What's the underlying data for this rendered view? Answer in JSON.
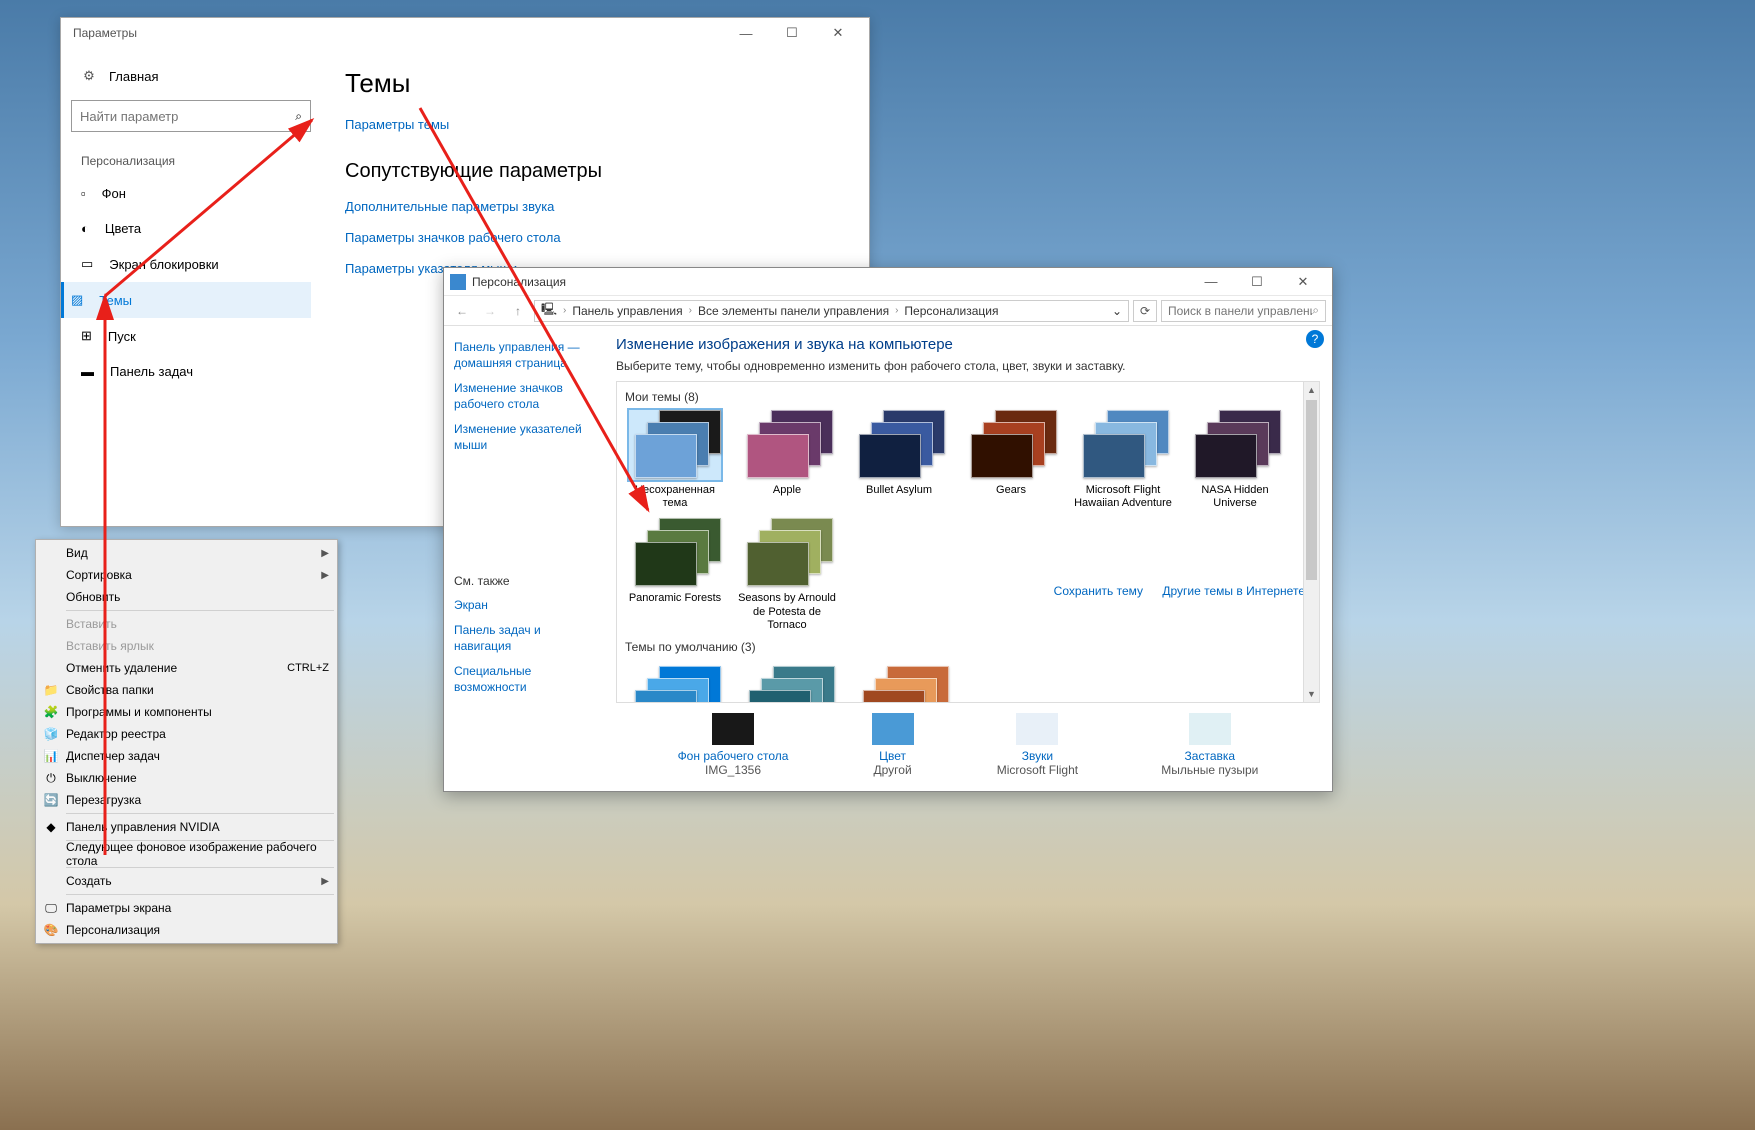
{
  "settings": {
    "title": "Параметры",
    "home": "Главная",
    "search_placeholder": "Найти параметр",
    "section_header": "Персонализация",
    "nav": [
      {
        "label": "Фон"
      },
      {
        "label": "Цвета"
      },
      {
        "label": "Экран блокировки"
      },
      {
        "label": "Темы"
      },
      {
        "label": "Пуск"
      },
      {
        "label": "Панель задач"
      }
    ],
    "page_title": "Темы",
    "link_theme_params": "Параметры темы",
    "related_header": "Сопутствующие параметры",
    "related_links": [
      "Дополнительные параметры звука",
      "Параметры значков рабочего стола",
      "Параметры указателя мыши"
    ]
  },
  "context_menu": {
    "items": [
      {
        "label": "Вид",
        "arrow": true
      },
      {
        "label": "Сортировка",
        "arrow": true
      },
      {
        "label": "Обновить"
      },
      {
        "sep": true
      },
      {
        "label": "Вставить",
        "disabled": true
      },
      {
        "label": "Вставить ярлык",
        "disabled": true
      },
      {
        "label": "Отменить удаление",
        "shortcut": "CTRL+Z"
      },
      {
        "label": "Свойства папки",
        "icon": "folder"
      },
      {
        "label": "Программы и компоненты",
        "icon": "programs"
      },
      {
        "label": "Редактор реестра",
        "icon": "regedit"
      },
      {
        "label": "Диспетчер задач",
        "icon": "taskmgr"
      },
      {
        "label": "Выключение",
        "icon": "power"
      },
      {
        "label": "Перезагрузка",
        "icon": "restart"
      },
      {
        "sep": true
      },
      {
        "label": "Панель управления NVIDIA",
        "icon": "nvidia"
      },
      {
        "sep": true
      },
      {
        "label": "Следующее фоновое изображение рабочего стола"
      },
      {
        "sep": true
      },
      {
        "label": "Создать",
        "arrow": true
      },
      {
        "sep": true
      },
      {
        "label": "Параметры экрана",
        "icon": "display"
      },
      {
        "label": "Персонализация",
        "icon": "personalize"
      }
    ]
  },
  "cp": {
    "title": "Персонализация",
    "breadcrumbs": [
      "Панель управления",
      "Все элементы панели управления",
      "Персонализация"
    ],
    "search_placeholder": "Поиск в панели управления",
    "side_links": [
      "Панель управления — домашняя страница",
      "Изменение значков рабочего стола",
      "Изменение указателей мыши"
    ],
    "see_also_header": "См. также",
    "see_also": [
      "Экран",
      "Панель задач и навигация",
      "Специальные возможности"
    ],
    "heading": "Изменение изображения и звука на компьютере",
    "subheading": "Выберите тему, чтобы одновременно изменить фон рабочего стола, цвет, звуки и заставку.",
    "my_themes_label": "Мои темы (8)",
    "themes": [
      {
        "label": "Несохраненная тема",
        "colors": [
          "#1a1a1a",
          "#4a7eb0",
          "#6da2d8"
        ],
        "selected": true
      },
      {
        "label": "Apple",
        "colors": [
          "#4a2f5a",
          "#6a3a6a",
          "#b05580"
        ]
      },
      {
        "label": "Bullet Asylum",
        "colors": [
          "#2a3a6a",
          "#3a5aa0",
          "#102040"
        ]
      },
      {
        "label": "Gears",
        "colors": [
          "#6a2a10",
          "#a84020",
          "#301000"
        ]
      },
      {
        "label": "Microsoft Flight Hawaiian Adventure",
        "colors": [
          "#5088c0",
          "#88b8e0",
          "#305880"
        ]
      },
      {
        "label": "NASA Hidden Universe",
        "colors": [
          "#3a2a4a",
          "#5a3a5a",
          "#201828"
        ]
      },
      {
        "label": "Panoramic Forests",
        "colors": [
          "#3a5a30",
          "#5a7a40",
          "#203818"
        ]
      },
      {
        "label": "Seasons by Arnould de Potesta de Tornaco",
        "colors": [
          "#7a8a50",
          "#a0b060",
          "#506030"
        ]
      }
    ],
    "save_theme": "Сохранить тему",
    "more_themes": "Другие темы в Интернете",
    "default_themes_label": "Темы по умолчанию (3)",
    "default_themes": [
      {
        "colors": [
          "#0078d7",
          "#4aa8e8",
          "#2a88c8"
        ]
      },
      {
        "colors": [
          "#3a7a8a",
          "#5a9aa8",
          "#206070"
        ]
      },
      {
        "colors": [
          "#c86a3a",
          "#e89a5a",
          "#a04820"
        ]
      }
    ],
    "bottom": [
      {
        "title": "Фон рабочего стола",
        "sub": "IMG_1356",
        "bg": "#181818"
      },
      {
        "title": "Цвет",
        "sub": "Другой",
        "bg": "#4a9ad6"
      },
      {
        "title": "Звуки",
        "sub": "Microsoft Flight",
        "bg": "#e8f0f8"
      },
      {
        "title": "Заставка",
        "sub": "Мыльные пузыри",
        "bg": "#e0f0f4"
      }
    ]
  }
}
